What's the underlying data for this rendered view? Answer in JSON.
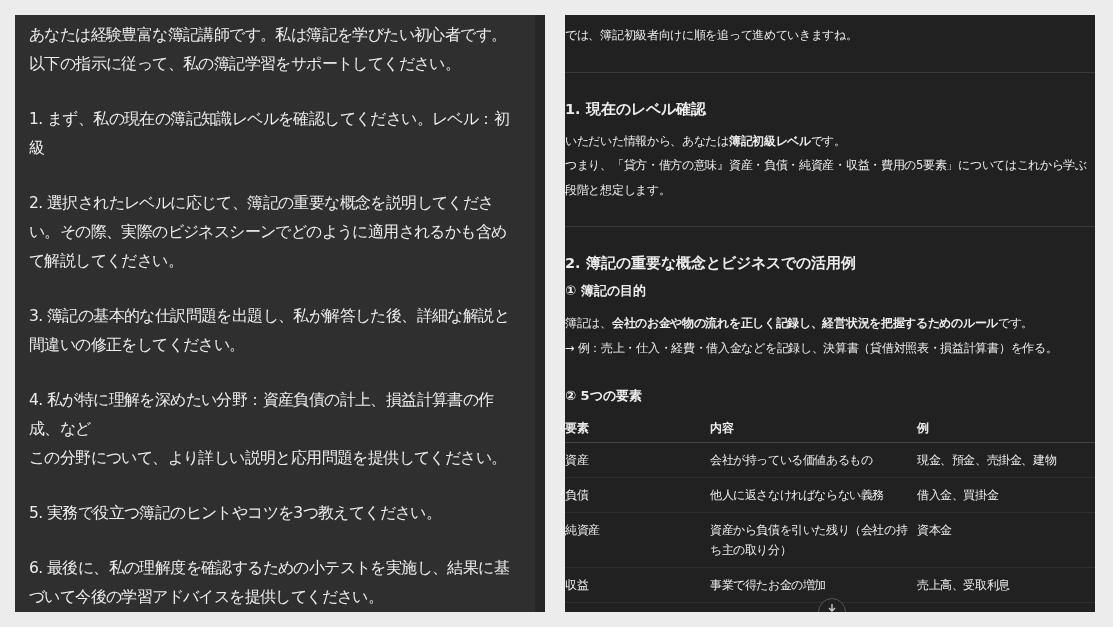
{
  "prompt": {
    "paragraphs": [
      {
        "lines": [
          "あなたは経験豊富な簿記講師です。私は簿記を学びたい初心者です。以下の指示に従って、私の簿記学習をサポートしてください。"
        ]
      },
      {
        "lines": [
          "1. まず、私の現在の簿記知識レベルを確認してください。レベル：初級"
        ]
      },
      {
        "lines": [
          "2. 選択されたレベルに応じて、簿記の重要な概念を説明してください。その際、実際のビジネスシーンでどのように適用されるかも含めて解説してください。"
        ]
      },
      {
        "lines": [
          "3. 簿記の基本的な仕訳問題を出題し、私が解答した後、詳細な解説と間違いの修正をしてください。"
        ]
      },
      {
        "lines": [
          "4. 私が特に理解を深めたい分野：資産負債の計上、損益計算書の作成、など",
          "この分野について、より詳しい説明と応用問題を提供してください。"
        ]
      },
      {
        "lines": [
          "5. 実務で役立つ簿記のヒントやコツを3つ教えてください。"
        ]
      },
      {
        "lines": [
          "6. 最後に、私の理解度を確認するための小テストを実施し、結果に基づいて今後の学習アドバイスを提供してください。"
        ]
      }
    ]
  },
  "response": {
    "blocks": [
      {
        "kind": "paragraph",
        "lines": [
          "では、簿記初級者向けに順を追って進めていきますね。"
        ]
      },
      {
        "kind": "divider"
      },
      {
        "kind": "heading",
        "text": "1. 現在のレベル確認"
      },
      {
        "kind": "paragraph",
        "lines": [
          "いただいた情報から、あなたは**簿記初級レベル**です。",
          "つまり、「貸方・借方の意味』資産・負債・純資産・収益・費用の5要素」についてはこれから学ぶ段階と想定します。"
        ]
      },
      {
        "kind": "divider"
      },
      {
        "kind": "heading",
        "text": "2. 簿記の重要な概念とビジネスでの活用例"
      },
      {
        "kind": "subheading",
        "text": "① 簿記の目的"
      },
      {
        "kind": "paragraph",
        "lines": [
          "簿記は、**会社のお金や物の流れを正しく記録し、経営状況を把握するためのルール**です。",
          "→ 例：売上・仕入・経費・借入金などを記録し、決算書（貸借対照表・損益計算書）を作る。"
        ]
      },
      {
        "kind": "subheading",
        "text": "② 5つの要素"
      },
      {
        "kind": "table",
        "columns": [
          "要素",
          "内容",
          "例"
        ],
        "rows": [
          [
            "資産",
            "会社が持っている価値あるもの",
            "現金、預金、売掛金、建物"
          ],
          [
            "負債",
            "他人に返さなければならない義務",
            "借入金、買掛金"
          ],
          [
            "純資産",
            "資産から負債を引いた残り（会社の持ち主の取り分）",
            "資本金"
          ],
          [
            "収益",
            "事業で得たお金の増加",
            "売上高、受取利息"
          ]
        ]
      }
    ]
  }
}
